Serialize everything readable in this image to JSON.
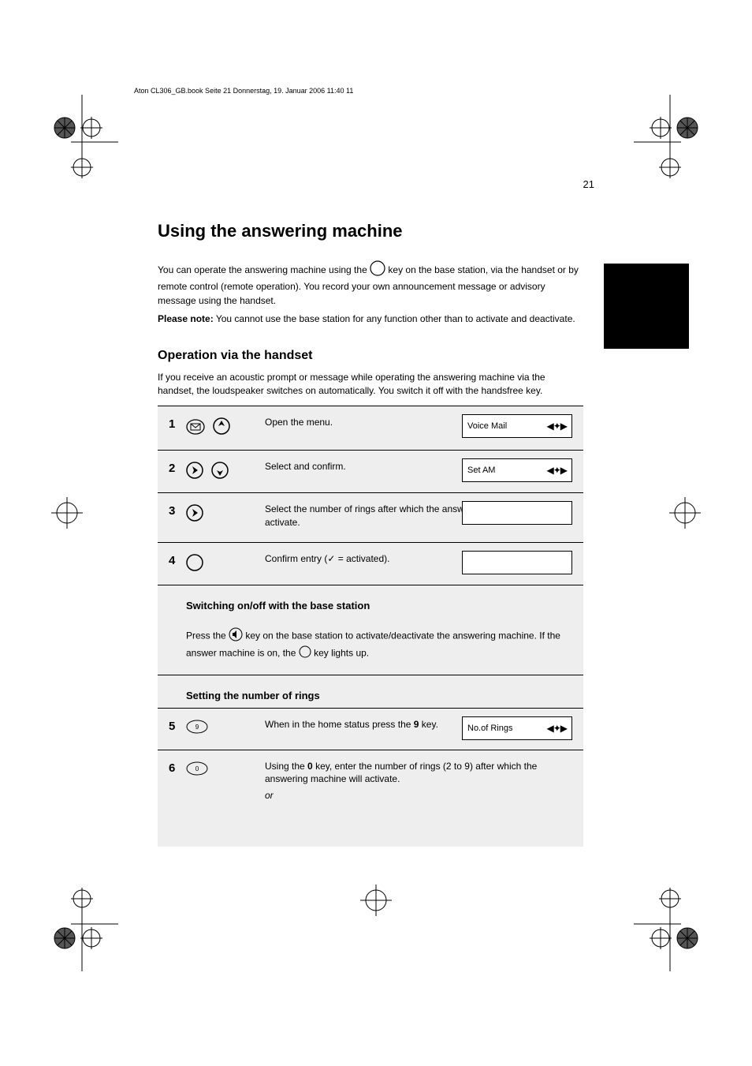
{
  "page_number": "21",
  "header_doc_line": "Aton CL306_GB.book  Seite 21  Donnerstag, 19. Januar 2006  11:40 11",
  "title": "Using the answering machine",
  "intro": {
    "p1_a": "You can operate the answering machine using the ",
    "p1_b": " key on the base station, via the handset or by remote control (remote operation). You record your own announcement message or advisory message using the handset.",
    "note_label": "Please note:",
    "note_body": "You cannot use the base station for any function other than to activate and deactivate."
  },
  "section_heading": "Operation via the handset",
  "intro2": "If you receive an acoustic prompt or message while operating the answering machine via the handset, the loudspeaker switches on automatically. You switch it off with the handsfree key.",
  "steps": {
    "s1": {
      "text": "Open the menu.",
      "lcd": "Voice Mail",
      "nav": true
    },
    "s2": {
      "text": "Select and confirm.",
      "lcd": "Set AM",
      "nav": true
    },
    "s3": {
      "text": "Select the number of rings after which the answering machine will activate.",
      "lcd": "",
      "nav": false
    },
    "s4": {
      "text_a": "Confirm entry (",
      "text_b": " = activated)."
    }
  },
  "subhead2": "Switching on/off with the base station",
  "base_row": {
    "text_a": "Press the ",
    "text_b": " key on the base station to activate/deactivate the answering machine. If the answer machine is on, the ",
    "text_c": " key lights up."
  },
  "subhead3": "Setting the number of rings",
  "s5": {
    "text_a": "When in the home status press the ",
    "text_b": " key.",
    "lcd": "No.of Rings",
    "nav": true
  },
  "s6": {
    "text_a": "Using the ",
    "text_b": " key, enter the number of rings (2 to 9) after which the answering machine will activate.",
    "p2": "or"
  }
}
